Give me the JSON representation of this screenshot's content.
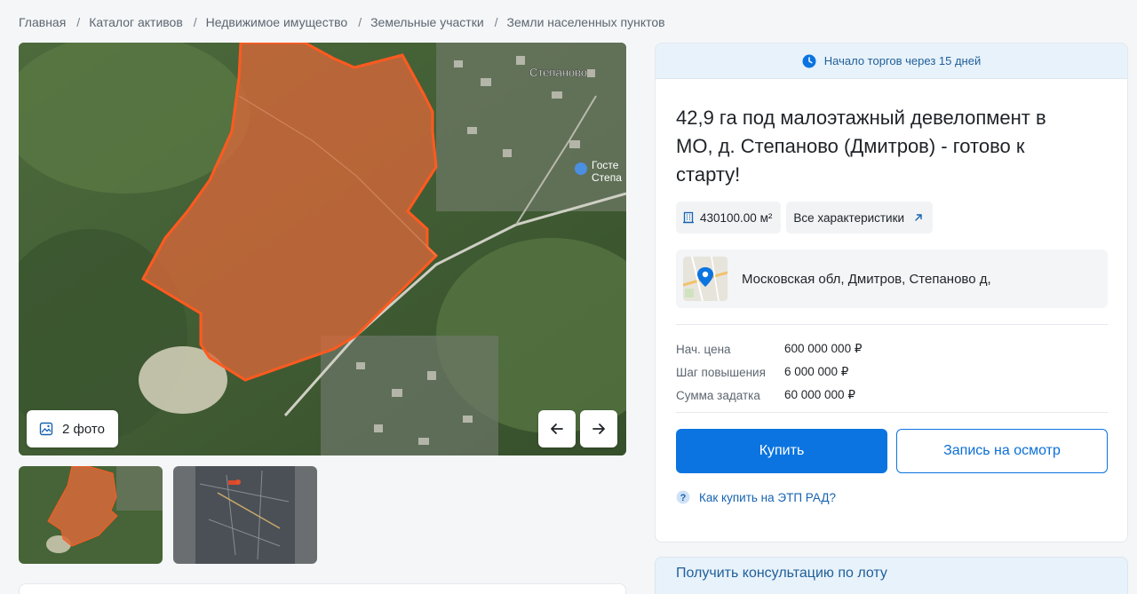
{
  "breadcrumb": [
    {
      "label": "Главная"
    },
    {
      "label": "Каталог активов"
    },
    {
      "label": "Недвижимое имущество"
    },
    {
      "label": "Земельные участки"
    },
    {
      "label": "Земли населенных пунктов"
    }
  ],
  "gallery": {
    "photo_count_label": "2 фото",
    "map_labels": {
      "village": "Степаново",
      "hotel_1": "Госте",
      "hotel_2": "Степа"
    }
  },
  "panel": {
    "auction_banner": "Начало торгов через 15 дней",
    "title": "42,9 га под малоэтажный девелопмент в МО, д. Степаново (Дмитров) - готово к старту!",
    "area_chip": "430100.00 м²",
    "specs_link": "Все характеристики",
    "address": "Московская обл, Дмитров, Степаново д,",
    "prices": [
      {
        "label": "Нач. цена",
        "value": "600 000 000 ₽"
      },
      {
        "label": "Шаг повышения",
        "value": "6 000 000 ₽"
      },
      {
        "label": "Сумма задатка",
        "value": "60 000 000 ₽"
      }
    ],
    "buy_button": "Купить",
    "viewing_button": "Запись на осмотр",
    "help_link": "Как купить на ЭТП РАД?"
  },
  "consult_banner": "Получить консультацию по лоту",
  "colors": {
    "accent": "#0b74e0",
    "plot_fill": "#d9683a",
    "banner_bg": "#e8f2fb"
  }
}
